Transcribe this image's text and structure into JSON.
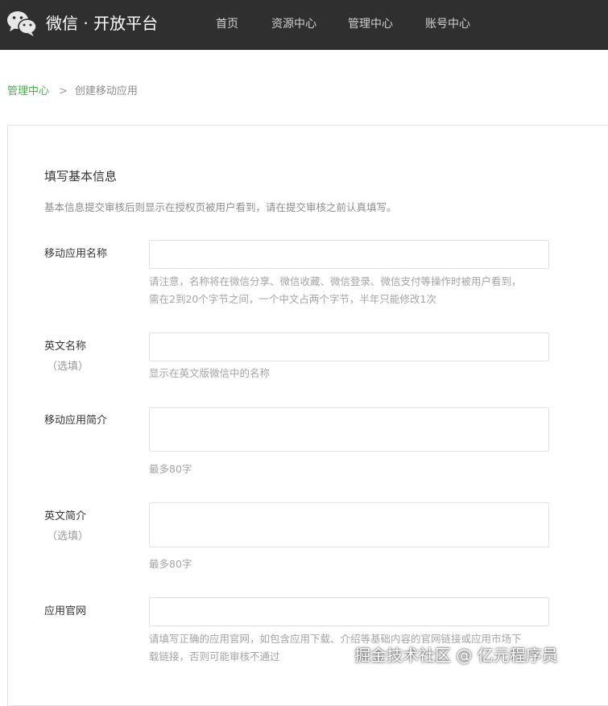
{
  "header": {
    "brand": "微信 · 开放平台",
    "nav": [
      "首页",
      "资源中心",
      "管理中心",
      "账号中心"
    ]
  },
  "breadcrumb": {
    "parent": "管理中心",
    "separator": ">",
    "current": "创建移动应用"
  },
  "form": {
    "section_title": "填写基本信息",
    "section_desc": "基本信息提交审核后则显示在授权页被用户看到，请在提交审核之前认真填写。",
    "fields": [
      {
        "label": "移动应用名称",
        "value": "",
        "hint_lines": [
          "请注意，名称将在微信分享、微信收藏、微信登录、微信支付等操作时被用户看到，",
          "需在2到20个字节之间，一个中文占两个字节，半年只能修改1次"
        ]
      },
      {
        "label": "英文名称",
        "optional": "（选填）",
        "value": "",
        "hint_lines": [
          "显示在英文版微信中的名称"
        ]
      },
      {
        "label": "移动应用简介",
        "value": "",
        "hint_lines": [
          "最多80字"
        ]
      },
      {
        "label": "英文简介",
        "optional": "（选填）",
        "value": "",
        "hint_lines": [
          "最多80字"
        ]
      },
      {
        "label": "应用官网",
        "value": "",
        "hint_lines": [
          "请填写正确的应用官网，如包含应用下载、介绍等基础内容的官网链接或应用市场下",
          "载链接，否则可能审核不通过"
        ]
      }
    ]
  },
  "watermark": "掘金技术社区 @ 亿元程序员",
  "colors": {
    "header_bg": "#2f2f2f",
    "accent": "#44b549",
    "hint": "#a4a4a4"
  }
}
